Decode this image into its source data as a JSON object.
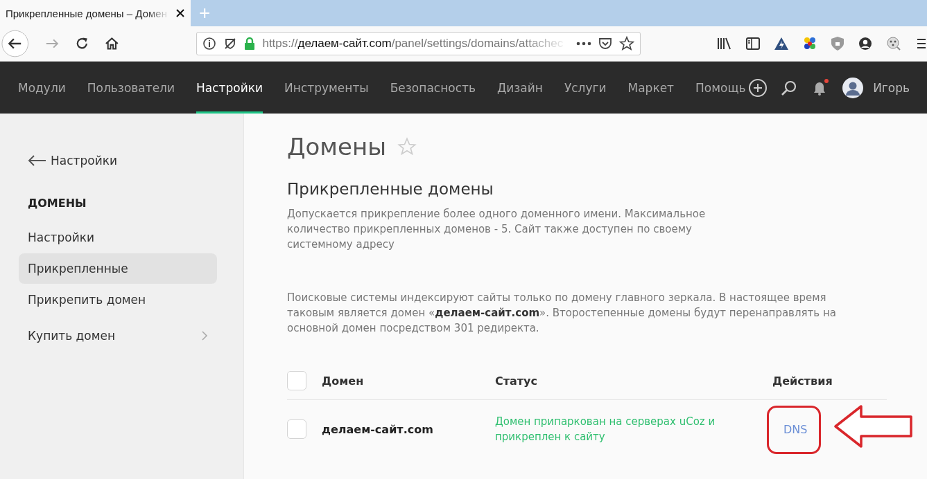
{
  "browser": {
    "tab_title": "Прикрепленные домены – Домен",
    "new_tab": "+",
    "url_scheme": "https://",
    "url_host": "делаем-сайт.com",
    "url_path": "/panel/settings/domains/attachec"
  },
  "nav": {
    "items": [
      {
        "label": "Модули",
        "selected": false
      },
      {
        "label": "Пользователи",
        "selected": false
      },
      {
        "label": "Настройки",
        "selected": true
      },
      {
        "label": "Инструменты",
        "selected": false
      },
      {
        "label": "Безопасность",
        "selected": false
      },
      {
        "label": "Дизайн",
        "selected": false
      },
      {
        "label": "Услуги",
        "selected": false
      },
      {
        "label": "Маркет",
        "selected": false
      },
      {
        "label": "Помощь",
        "selected": false
      }
    ],
    "notifications_unread": true,
    "user": "Игорь"
  },
  "sidebar": {
    "back": "Настройки",
    "section": "ДОМЕНЫ",
    "items": [
      {
        "label": "Настройки",
        "selected": false,
        "has_submenu": false
      },
      {
        "label": "Прикрепленные",
        "selected": true,
        "has_submenu": false
      },
      {
        "label": "Прикрепить домен",
        "selected": false,
        "has_submenu": false
      },
      {
        "label": "Купить домен",
        "selected": false,
        "has_submenu": true
      }
    ]
  },
  "page": {
    "title": "Домены",
    "favorite": false,
    "subtitle": "Прикрепленные домены",
    "intro": "Допускается прикрепление более одного доменного имени. Максимальное количество прикрепленных доменов - 5. Сайт также доступен по своему системному адресу",
    "mirror_note": "Поисковые системы индексируют сайты только по домену главного зеркала. В настоящее время таковым является домен «**делаем-сайт.com**». Второстепенные домены будут перенаправлять на основной домен посредством 301 редиректа."
  },
  "table": {
    "all_checked": false,
    "columns": [
      "Домен",
      "Статус",
      "Действия"
    ],
    "rows": [
      {
        "checked": false,
        "domain": "делаем-сайт.com",
        "status": "Домен припаркован на серверах uCoz и прикреплен к сайту",
        "action": "DNS"
      }
    ]
  },
  "annotation": {
    "highlight_action": true
  }
}
